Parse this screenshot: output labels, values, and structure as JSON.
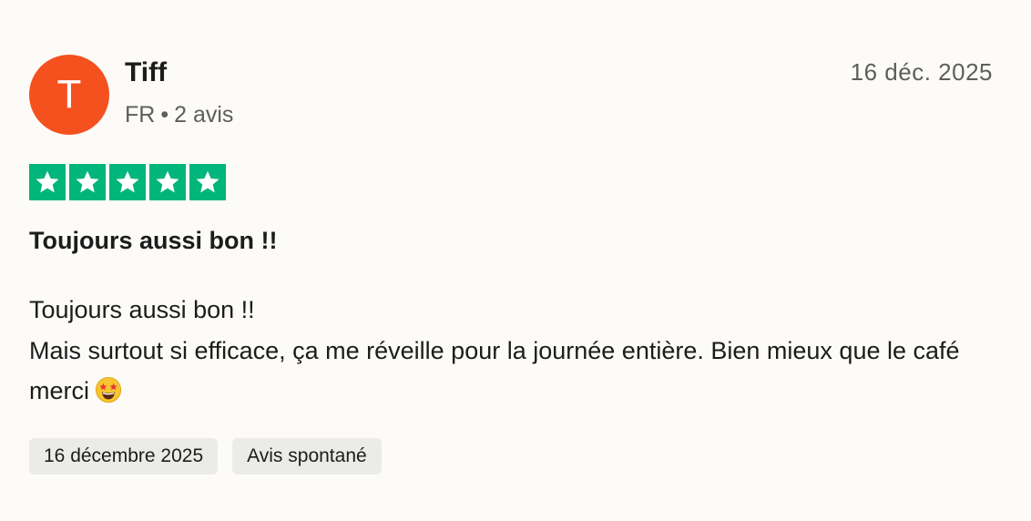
{
  "review": {
    "author": {
      "initial": "T",
      "name": "Tiff",
      "country": "FR",
      "separator": "•",
      "reviews_count": "2 avis",
      "avatar_color": "#f4511e"
    },
    "date_short": "16 déc. 2025",
    "rating": {
      "stars": 5,
      "max": 5,
      "color": "#00b67a"
    },
    "title": "Toujours aussi bon !!",
    "body": {
      "line1": "Toujours aussi bon !!",
      "line2": "Mais surtout si efficace, ça me réveille pour la journée entière. Bien mieux que le café merci",
      "emoji": "star-struck-emoji"
    },
    "tags": [
      "16 décembre 2025",
      "Avis spontané"
    ]
  }
}
